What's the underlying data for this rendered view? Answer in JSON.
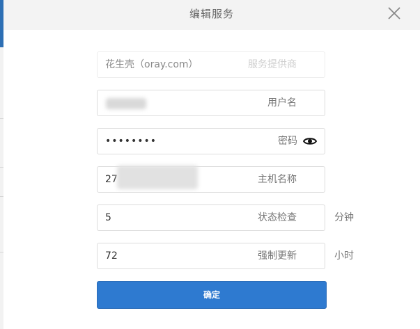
{
  "dialog": {
    "title": "编辑服务",
    "close_icon": "close-icon"
  },
  "form": {
    "provider": {
      "value": "花生壳（oray.com）",
      "label": "服务提供商"
    },
    "username": {
      "label": "用户名"
    },
    "password": {
      "value": "••••••••",
      "label": "密码",
      "icon": "eye-icon"
    },
    "hostname": {
      "value": "27",
      "label": "主机名称"
    },
    "status_check": {
      "value": "5",
      "label": "状态检查",
      "unit": "分钟"
    },
    "force_update": {
      "value": "72",
      "label": "强制更新",
      "unit": "小时"
    },
    "confirm_label": "确定"
  },
  "colors": {
    "primary": "#2e7ad0",
    "header_bg": "#f3f3f3",
    "border": "#dcdcdc"
  }
}
